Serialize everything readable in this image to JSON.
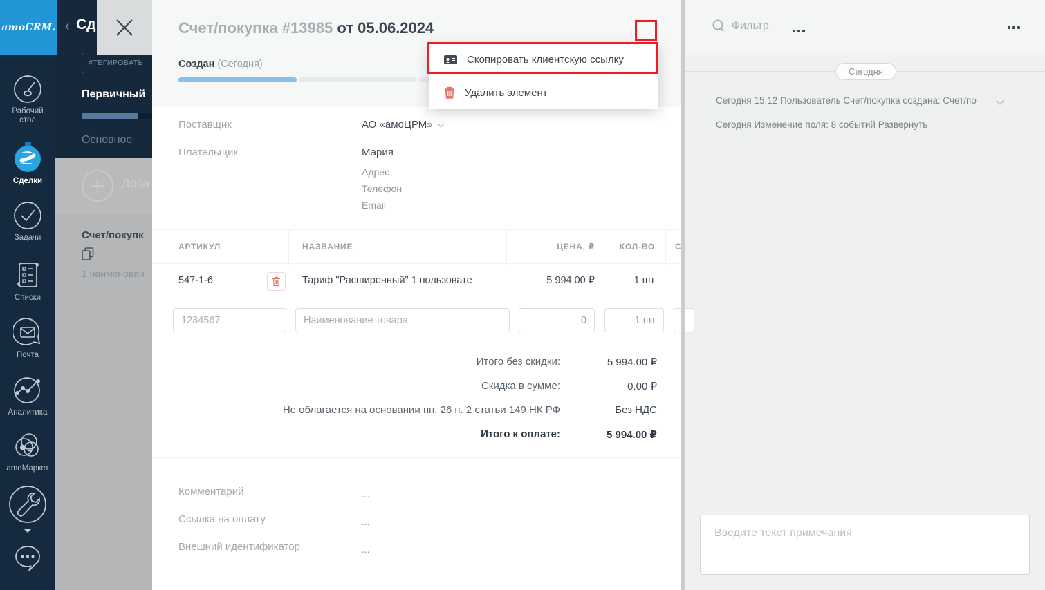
{
  "app": {
    "brand": "amoCRM."
  },
  "sidebar": {
    "items": [
      {
        "label": "Рабочий стол",
        "icon": "dashboard-icon"
      },
      {
        "label": "Сделки",
        "icon": "deals-icon"
      },
      {
        "label": "Задачи",
        "icon": "tasks-icon"
      },
      {
        "label": "Списки",
        "icon": "lists-icon"
      },
      {
        "label": "Почта",
        "icon": "mail-icon"
      },
      {
        "label": "Аналитика",
        "icon": "analytics-icon"
      },
      {
        "label": "amoМаркет",
        "icon": "market-icon"
      }
    ]
  },
  "background_page": {
    "back": "‹",
    "title": "Сд",
    "tag_placeholder": "#ТЕГИРОВАТЬ",
    "pipeline_status": "Первичный",
    "tab": "Основное",
    "add_label": "Доба",
    "item_title": "Счет/покупк",
    "item_sub": "1 наименован"
  },
  "modal": {
    "title_gray": "Счет/покупка #13985",
    "title_dark": "от 05.06.2024",
    "status": {
      "label": "Создан",
      "sub": "(Сегодня)"
    },
    "menu": {
      "items": [
        {
          "label": "Скопировать клиентскую ссылку"
        },
        {
          "label": "Удалить элемент"
        }
      ]
    },
    "fields": {
      "supplier_label": "Поставщик",
      "supplier_value": "АО «амоЦРМ»",
      "payer_label": "Плательщик",
      "payer_value": "Мария",
      "payer_sub": [
        "Адрес",
        "Телефон",
        "Email"
      ]
    },
    "table": {
      "headers": [
        "АРТИКУЛ",
        "НАЗВАНИЕ",
        "ЦЕНА, ₽",
        "КОЛ-ВО",
        "С"
      ],
      "row": {
        "sku": "547-1-6",
        "name": "Тариф \"Расширенный\" 1 пользовате",
        "price": "5 994.00 ₽",
        "qty": "1 шт"
      },
      "new_row": {
        "sku_placeholder": "1234567",
        "name_placeholder": "Наименование товара",
        "price_value": "0",
        "qty_value": "1 шт"
      }
    },
    "totals": [
      {
        "label": "Итого без скидки:",
        "value": "5 994.00 ₽"
      },
      {
        "label": "Скидка в сумме:",
        "value": "0.00 ₽"
      },
      {
        "label": "Не облагается на основании пп. 26 п. 2 статьи 149 НК РФ",
        "value": "Без НДС"
      },
      {
        "label": "Итого к оплате:",
        "value": "5 994.00 ₽"
      }
    ],
    "extra_fields": [
      {
        "label": "Комментарий",
        "value": "..."
      },
      {
        "label": "Ссылка на оплату",
        "value": "..."
      },
      {
        "label": "Внешний идентификатор",
        "value": "..."
      }
    ]
  },
  "right_panel": {
    "filter_placeholder": "Фильтр",
    "day_divider": "Сегодня",
    "feed": [
      {
        "text": "Сегодня 15:12 Пользователь Счет/покупка создана: Счет/по"
      },
      {
        "text": "Сегодня Изменение поля: 8 событий ",
        "link": "Развернуть"
      }
    ],
    "note_placeholder": "Введите текст примечания"
  },
  "colors": {
    "brand_blue": "#2195d6",
    "sidebar_navy": "#152a3e",
    "progress_blue": "#86c0ec",
    "pipeline_steel": "#56799c",
    "annotation_red": "#ee1c25",
    "delete_salmon": "#e2766f"
  }
}
